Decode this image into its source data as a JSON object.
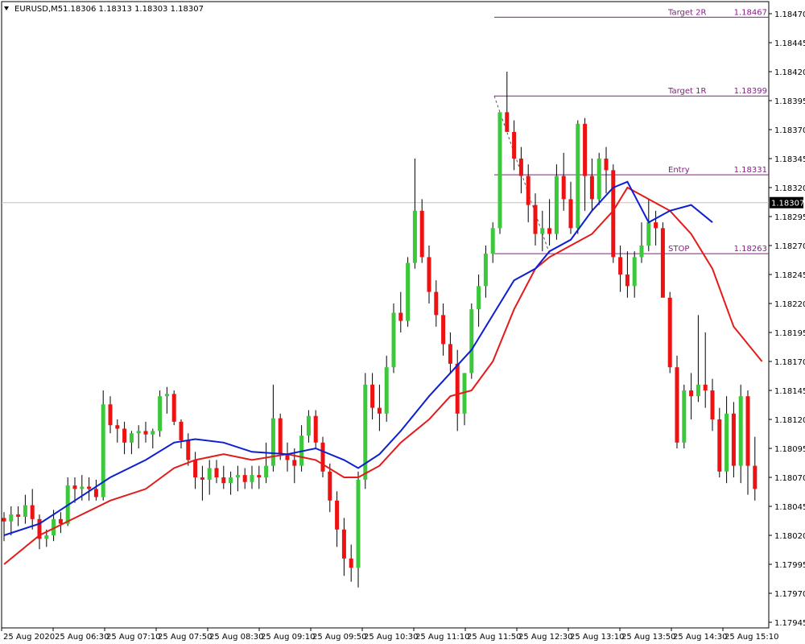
{
  "header": {
    "symbol": "EURUSD,M5",
    "ohlc": "1.18306 1.18313 1.18303 1.18307"
  },
  "colors": {
    "bull": "#3bc83b",
    "bear": "#ee1111",
    "wick": "#000000",
    "ma_fast": "#0d1fd1",
    "ma_slow": "#e31b1b",
    "levels": "#8b1a8b",
    "current_line": "#c0c0c0",
    "current_label_bg": "#000000"
  },
  "chart_data": {
    "type": "candlestick",
    "symbol": "EURUSD",
    "timeframe": "M5",
    "ylim": [
      1.17935,
      1.18485
    ],
    "y_ticks": [
      "1.18470",
      "1.18445",
      "1.18420",
      "1.18395",
      "1.18370",
      "1.18345",
      "1.18320",
      "1.18295",
      "1.18270",
      "1.18245",
      "1.18220",
      "1.18195",
      "1.18170",
      "1.18145",
      "1.18120",
      "1.18095",
      "1.18070",
      "1.18045",
      "1.18020",
      "1.17995",
      "1.17970",
      "1.17945"
    ],
    "x_tick_labels": [
      "25 Aug 2020",
      "25 Aug 06:30",
      "25 Aug 07:10",
      "25 Aug 07:50",
      "25 Aug 08:30",
      "25 Aug 09:10",
      "25 Aug 09:50",
      "25 Aug 10:30",
      "25 Aug 11:10",
      "25 Aug 11:50",
      "25 Aug 12:30",
      "25 Aug 13:10",
      "25 Aug 13:50",
      "25 Aug 14:30",
      "25 Aug 15:10"
    ],
    "current_price": "1.18307",
    "levels": [
      {
        "name": "Target 2R",
        "price": "1.18467",
        "value": 1.18467,
        "from_candle": 70
      },
      {
        "name": "Target 1R",
        "price": "1.18399",
        "value": 1.18399,
        "from_candle": 70
      },
      {
        "name": "Entry",
        "price": "1.18331",
        "value": 1.18331,
        "from_candle": 70
      },
      {
        "name": "STOP",
        "price": "1.18263",
        "value": 1.18263,
        "from_candle": 70
      }
    ],
    "candles": [
      [
        1.18035,
        1.1804,
        1.18015,
        1.18032
      ],
      [
        1.18032,
        1.18045,
        1.1802,
        1.18038
      ],
      [
        1.18038,
        1.18045,
        1.18028,
        1.18036
      ],
      [
        1.18036,
        1.18055,
        1.1803,
        1.18046
      ],
      [
        1.18046,
        1.1806,
        1.18025,
        1.18034
      ],
      [
        1.18034,
        1.18038,
        1.18008,
        1.18017
      ],
      [
        1.18017,
        1.18025,
        1.1801,
        1.1802
      ],
      [
        1.1802,
        1.18042,
        1.18015,
        1.18034
      ],
      [
        1.18034,
        1.1804,
        1.18022,
        1.1803
      ],
      [
        1.1803,
        1.1807,
        1.18028,
        1.18063
      ],
      [
        1.18063,
        1.1807,
        1.18048,
        1.1806
      ],
      [
        1.1806,
        1.18072,
        1.1805,
        1.18062
      ],
      [
        1.18062,
        1.1807,
        1.1805,
        1.1806
      ],
      [
        1.1806,
        1.18068,
        1.1805,
        1.18053
      ],
      [
        1.18053,
        1.18145,
        1.1805,
        1.18133
      ],
      [
        1.18133,
        1.1814,
        1.18108,
        1.18115
      ],
      [
        1.18115,
        1.1812,
        1.181,
        1.18112
      ],
      [
        1.18112,
        1.18118,
        1.1809,
        1.181
      ],
      [
        1.181,
        1.1811,
        1.1809,
        1.18108
      ],
      [
        1.18108,
        1.18115,
        1.18095,
        1.1811
      ],
      [
        1.1811,
        1.18118,
        1.181,
        1.18107
      ],
      [
        1.18107,
        1.18112,
        1.18095,
        1.1811
      ],
      [
        1.1811,
        1.18145,
        1.18105,
        1.1814
      ],
      [
        1.1814,
        1.18148,
        1.18125,
        1.18142
      ],
      [
        1.18142,
        1.18145,
        1.18115,
        1.18118
      ],
      [
        1.18118,
        1.1812,
        1.18095,
        1.18102
      ],
      [
        1.18102,
        1.18108,
        1.1808,
        1.18085
      ],
      [
        1.18085,
        1.18092,
        1.1806,
        1.1807
      ],
      [
        1.1807,
        1.1808,
        1.1805,
        1.18068
      ],
      [
        1.18068,
        1.18085,
        1.18055,
        1.18078
      ],
      [
        1.18078,
        1.18085,
        1.18065,
        1.1807
      ],
      [
        1.1807,
        1.1808,
        1.1806,
        1.18065
      ],
      [
        1.18065,
        1.18075,
        1.18055,
        1.1807
      ],
      [
        1.1807,
        1.1808,
        1.18058,
        1.18072
      ],
      [
        1.18072,
        1.18078,
        1.1806,
        1.18066
      ],
      [
        1.18066,
        1.1808,
        1.1806,
        1.18072
      ],
      [
        1.18072,
        1.1808,
        1.1806,
        1.1807
      ],
      [
        1.1807,
        1.181,
        1.18065,
        1.1808
      ],
      [
        1.1808,
        1.1815,
        1.18075,
        1.18121
      ],
      [
        1.18121,
        1.18125,
        1.18085,
        1.1809
      ],
      [
        1.1809,
        1.181,
        1.18075,
        1.18085
      ],
      [
        1.18085,
        1.18095,
        1.18065,
        1.1808
      ],
      [
        1.1808,
        1.18115,
        1.18075,
        1.18106
      ],
      [
        1.18106,
        1.18128,
        1.181,
        1.18123
      ],
      [
        1.18123,
        1.18128,
        1.18095,
        1.181
      ],
      [
        1.181,
        1.18105,
        1.1807,
        1.18075
      ],
      [
        1.18075,
        1.18082,
        1.1804,
        1.1805
      ],
      [
        1.1805,
        1.18058,
        1.1801,
        1.18025
      ],
      [
        1.18025,
        1.18035,
        1.17985,
        1.18
      ],
      [
        1.18,
        1.18012,
        1.1798,
        1.17992
      ],
      [
        1.17992,
        1.18075,
        1.17975,
        1.18068
      ],
      [
        1.18068,
        1.1816,
        1.1806,
        1.1815
      ],
      [
        1.1815,
        1.1816,
        1.1812,
        1.1813
      ],
      [
        1.1813,
        1.1815,
        1.1811,
        1.18125
      ],
      [
        1.18125,
        1.18175,
        1.18118,
        1.18165
      ],
      [
        1.18165,
        1.1822,
        1.1816,
        1.18212
      ],
      [
        1.18212,
        1.1823,
        1.18195,
        1.18205
      ],
      [
        1.18205,
        1.1826,
        1.182,
        1.18255
      ],
      [
        1.18255,
        1.18345,
        1.1825,
        1.183
      ],
      [
        1.183,
        1.1831,
        1.18255,
        1.1826
      ],
      [
        1.1826,
        1.1827,
        1.1822,
        1.1823
      ],
      [
        1.1823,
        1.1824,
        1.182,
        1.1821
      ],
      [
        1.1821,
        1.1822,
        1.18175,
        1.18185
      ],
      [
        1.18185,
        1.18195,
        1.1816,
        1.18168
      ],
      [
        1.18168,
        1.1818,
        1.1811,
        1.18125
      ],
      [
        1.18125,
        1.1816,
        1.18115,
        1.1816
      ],
      [
        1.1816,
        1.1822,
        1.18155,
        1.18215
      ],
      [
        1.18215,
        1.18245,
        1.182,
        1.18235
      ],
      [
        1.18235,
        1.1827,
        1.18225,
        1.18263
      ],
      [
        1.18263,
        1.1829,
        1.18255,
        1.18285
      ],
      [
        1.18285,
        1.18385,
        1.1828,
        1.18385
      ],
      [
        1.18385,
        1.1842,
        1.1837,
        1.18368
      ],
      [
        1.18368,
        1.18378,
        1.18335,
        1.18345
      ],
      [
        1.18345,
        1.18355,
        1.18315,
        1.1833
      ],
      [
        1.1833,
        1.1834,
        1.1829,
        1.18305
      ],
      [
        1.18305,
        1.18315,
        1.1827,
        1.1828
      ],
      [
        1.1828,
        1.183,
        1.18265,
        1.18285
      ],
      [
        1.18285,
        1.1831,
        1.1827,
        1.1828
      ],
      [
        1.1828,
        1.1834,
        1.18275,
        1.1833
      ],
      [
        1.1833,
        1.1835,
        1.183,
        1.1831
      ],
      [
        1.1831,
        1.18325,
        1.1828,
        1.18285
      ],
      [
        1.18285,
        1.18378,
        1.1828,
        1.18375
      ],
      [
        1.18375,
        1.1838,
        1.183,
        1.1833
      ],
      [
        1.1833,
        1.18345,
        1.183,
        1.1831
      ],
      [
        1.1831,
        1.1835,
        1.18305,
        1.18345
      ],
      [
        1.18345,
        1.18355,
        1.18315,
        1.18335
      ],
      [
        1.18335,
        1.1834,
        1.18255,
        1.1826
      ],
      [
        1.1826,
        1.1827,
        1.1823,
        1.18245
      ],
      [
        1.18245,
        1.18265,
        1.18225,
        1.18235
      ],
      [
        1.18235,
        1.18265,
        1.18225,
        1.1826
      ],
      [
        1.1826,
        1.1829,
        1.18255,
        1.1827
      ],
      [
        1.1827,
        1.1831,
        1.18265,
        1.1829
      ],
      [
        1.1829,
        1.183,
        1.1827,
        1.18285
      ],
      [
        1.18285,
        1.1829,
        1.1823,
        1.18225
      ],
      [
        1.18225,
        1.1823,
        1.1816,
        1.18165
      ],
      [
        1.18165,
        1.18175,
        1.18095,
        1.181
      ],
      [
        1.181,
        1.1815,
        1.18095,
        1.18145
      ],
      [
        1.18145,
        1.1816,
        1.1812,
        1.1814
      ],
      [
        1.1814,
        1.1821,
        1.18135,
        1.1815
      ],
      [
        1.1815,
        1.18195,
        1.1813,
        1.18145
      ],
      [
        1.18145,
        1.18155,
        1.1811,
        1.1812
      ],
      [
        1.1812,
        1.1813,
        1.1807,
        1.18075
      ],
      [
        1.18075,
        1.1814,
        1.18065,
        1.18125
      ],
      [
        1.18125,
        1.18135,
        1.1807,
        1.1808
      ],
      [
        1.1808,
        1.1815,
        1.18065,
        1.1814
      ],
      [
        1.1814,
        1.18145,
        1.18055,
        1.1808
      ],
      [
        1.1808,
        1.18105,
        1.1805,
        1.1806
      ]
    ],
    "ma_fast": [
      [
        0,
        1.1802
      ],
      [
        5,
        1.1803
      ],
      [
        10,
        1.1805
      ],
      [
        15,
        1.1807
      ],
      [
        20,
        1.18085
      ],
      [
        24,
        1.181
      ],
      [
        27,
        1.18103
      ],
      [
        31,
        1.181
      ],
      [
        35,
        1.18092
      ],
      [
        40,
        1.1809
      ],
      [
        44,
        1.18095
      ],
      [
        48,
        1.18085
      ],
      [
        50,
        1.18078
      ],
      [
        53,
        1.1809
      ],
      [
        56,
        1.1811
      ],
      [
        60,
        1.1814
      ],
      [
        63,
        1.1816
      ],
      [
        66,
        1.1818
      ],
      [
        69,
        1.1821
      ],
      [
        72,
        1.1824
      ],
      [
        75,
        1.1825
      ],
      [
        77,
        1.18265
      ],
      [
        80,
        1.18275
      ],
      [
        83,
        1.183
      ],
      [
        86,
        1.1832
      ],
      [
        88,
        1.18325
      ],
      [
        91,
        1.1829
      ],
      [
        94,
        1.183
      ],
      [
        97,
        1.18305
      ],
      [
        100,
        1.1829
      ]
    ],
    "ma_slow": [
      [
        0,
        1.17995
      ],
      [
        5,
        1.1802
      ],
      [
        10,
        1.18035
      ],
      [
        15,
        1.1805
      ],
      [
        20,
        1.1806
      ],
      [
        24,
        1.18078
      ],
      [
        27,
        1.18085
      ],
      [
        31,
        1.1809
      ],
      [
        35,
        1.18085
      ],
      [
        40,
        1.1809
      ],
      [
        44,
        1.18085
      ],
      [
        48,
        1.1807
      ],
      [
        50,
        1.1807
      ],
      [
        53,
        1.1808
      ],
      [
        56,
        1.181
      ],
      [
        60,
        1.1812
      ],
      [
        63,
        1.1814
      ],
      [
        66,
        1.18145
      ],
      [
        69,
        1.1817
      ],
      [
        72,
        1.18215
      ],
      [
        75,
        1.1825
      ],
      [
        77,
        1.1826
      ],
      [
        80,
        1.1827
      ],
      [
        83,
        1.1828
      ],
      [
        86,
        1.183
      ],
      [
        88,
        1.1832
      ],
      [
        91,
        1.1831
      ],
      [
        94,
        1.183
      ],
      [
        97,
        1.1828
      ],
      [
        100,
        1.1825
      ],
      [
        103,
        1.182
      ],
      [
        107,
        1.1817
      ]
    ]
  }
}
